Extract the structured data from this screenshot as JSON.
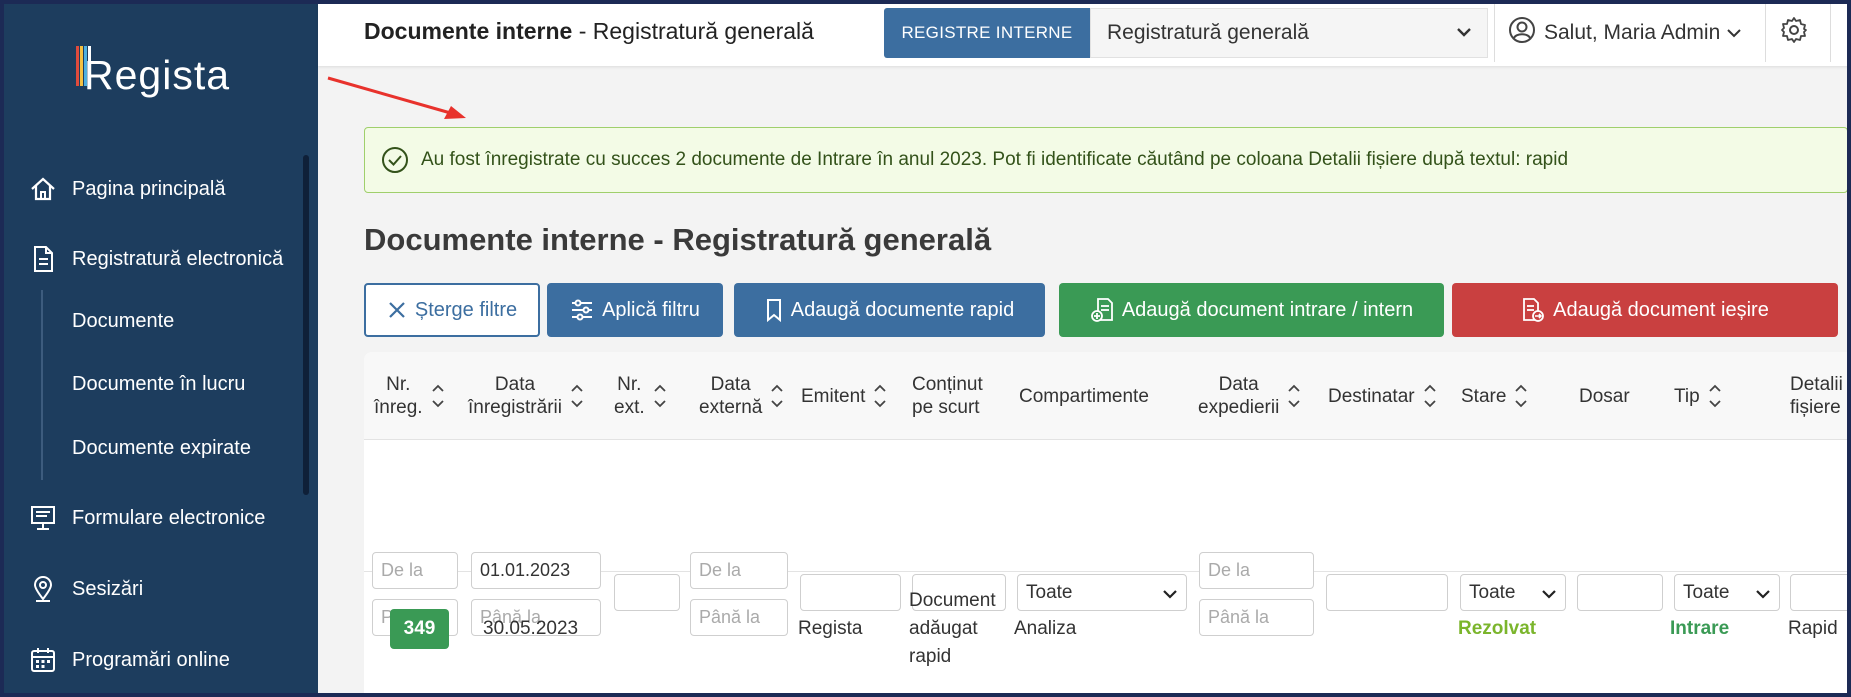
{
  "sidebar": {
    "logo": "Regista",
    "logo_colors": [
      "#e04b3c",
      "#f4c142",
      "#4fb0e0",
      "#ffffff"
    ],
    "items": [
      {
        "label": "Pagina principală",
        "icon": "home-icon"
      },
      {
        "label": "Registratură electronică",
        "icon": "document-icon"
      },
      {
        "label": "Formulare electronice",
        "icon": "monitor-form-icon"
      },
      {
        "label": "Sesizări",
        "icon": "location-pin-icon"
      },
      {
        "label": "Programări online",
        "icon": "calendar-icon"
      }
    ],
    "sub_items": [
      "Documente",
      "Documente în lucru",
      "Documente expirate"
    ]
  },
  "header": {
    "title_bold": "Documente interne",
    "title_rest": " - Registratură generală",
    "registers_button": "REGISTRE INTERNE",
    "register_select": "Registratură generală",
    "user_greeting": "Salut, Maria Admin"
  },
  "alert": {
    "text": "Au fost înregistrate cu succes 2 documente de Intrare în anul 2023. Pot fi identificate căutând pe coloana Detalii fișiere după textul: rapid"
  },
  "page_title": "Documente interne - Registratură generală",
  "buttons": {
    "clear": "Șterge filtre",
    "apply": "Aplică filtru",
    "quick_add": "Adaugă documente rapid",
    "add_in": "Adaugă document intrare / intern",
    "add_out": "Adaugă document ieșire"
  },
  "table": {
    "columns": [
      {
        "l1": "Nr.",
        "l2": "înreg."
      },
      {
        "l1": "Data",
        "l2": "înregistrării"
      },
      {
        "l1": "Nr.",
        "l2": "ext."
      },
      {
        "l1": "Data",
        "l2": "externă"
      },
      {
        "l1": "Emitent",
        "l2": ""
      },
      {
        "l1": "Conținut",
        "l2": "pe scurt"
      },
      {
        "l1": "Compartimente",
        "l2": ""
      },
      {
        "l1": "Data",
        "l2": "expedierii"
      },
      {
        "l1": "Destinatar",
        "l2": ""
      },
      {
        "l1": "Stare",
        "l2": ""
      },
      {
        "l1": "Dosar",
        "l2": ""
      },
      {
        "l1": "Tip",
        "l2": ""
      },
      {
        "l1": "Detalii",
        "l2": "fișiere"
      }
    ],
    "filters": {
      "from_placeholder": "De la",
      "to_placeholder": "Până la",
      "reg_date_from": "01.01.2023",
      "select_all": "Toate"
    },
    "rows": [
      {
        "nr": "349",
        "date": "30.05.2023",
        "emitent": "Regista",
        "content_l1": "Document",
        "content_l2": "adăugat",
        "content_l3": "rapid",
        "department": "Analiza",
        "status": "Rezolvat",
        "type": "Intrare",
        "details": "Rapid"
      }
    ]
  }
}
